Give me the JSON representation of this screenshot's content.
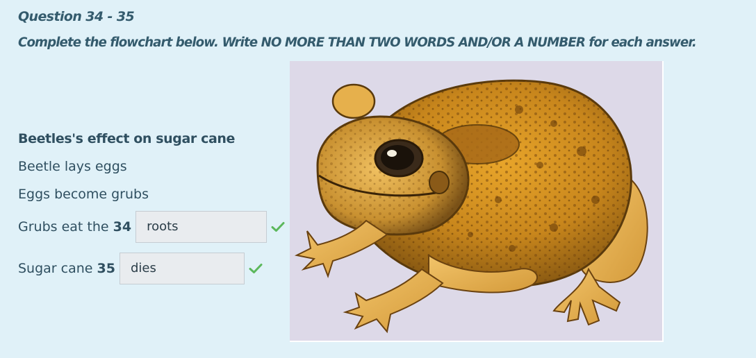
{
  "question": {
    "title": "Question 34 - 35",
    "instructions": "Complete the flowchart below. Write NO MORE THAN TWO WORDS AND/OR A NUMBER for each answer."
  },
  "flowchart": {
    "heading": "Beetles's effect on sugar cane",
    "steps": [
      {
        "text": "Beetle lays eggs"
      },
      {
        "text": "Eggs become grubs"
      },
      {
        "prefix": "Grubs eat the",
        "number": "34",
        "answer": "roots",
        "status": "correct"
      },
      {
        "prefix": "Sugar cane",
        "number": "35",
        "answer": "dies",
        "status": "correct"
      }
    ]
  },
  "image": {
    "subject": "cane toad illustration",
    "icon": "toad-illustration"
  },
  "colors": {
    "background": "#e0f1f8",
    "heading_text": "#345b6d",
    "body_text": "#2f4f60",
    "input_bg": "#e9ecef",
    "check": "#5cb85c",
    "image_bg": "#ddd9e8"
  }
}
